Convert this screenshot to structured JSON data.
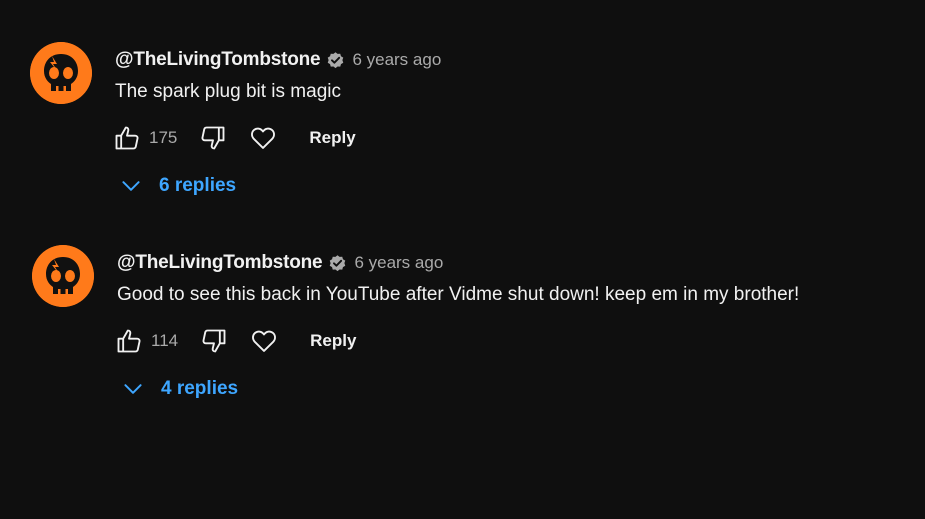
{
  "colors": {
    "background": "#0f0f0f",
    "text": "#f1f1f1",
    "secondary_text": "#aaaaaa",
    "link_blue": "#3ea6ff",
    "avatar_orange": "#ff7a1a"
  },
  "comments": [
    {
      "author": "@TheLivingTombstone",
      "time": "6 years ago",
      "text": "The spark plug bit is magic",
      "likes": "175",
      "reply_label": "Reply",
      "replies_label": "6 replies",
      "icons": [
        "skull-avatar",
        "verified-badge-icon",
        "thumbs-up-icon",
        "thumbs-down-icon",
        "heart-icon",
        "chevron-down-icon"
      ]
    },
    {
      "author": "@TheLivingTombstone",
      "time": "6 years ago",
      "text": "Good to see this back in YouTube after Vidme shut down! keep em in my brother!",
      "likes": "114",
      "reply_label": "Reply",
      "replies_label": "4 replies",
      "icons": [
        "skull-avatar",
        "verified-badge-icon",
        "thumbs-up-icon",
        "thumbs-down-icon",
        "heart-icon",
        "chevron-down-icon"
      ]
    }
  ]
}
